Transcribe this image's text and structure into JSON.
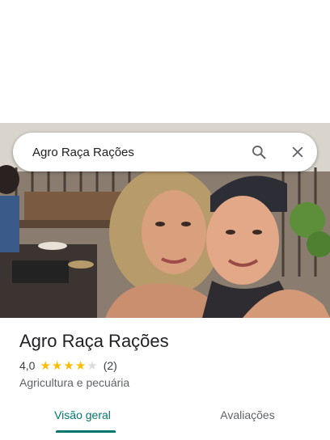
{
  "search": {
    "query": "Agro Raça Rações",
    "search_icon": "search-icon",
    "clear_icon": "close-icon"
  },
  "hero_photo": {
    "icon": "place-photo"
  },
  "place": {
    "name": "Agro Raça Rações",
    "rating": "4,0",
    "rating_value": 4,
    "max_stars": 5,
    "review_count": "(2)",
    "category": "Agricultura e pecuária"
  },
  "tabs": [
    {
      "label": "Visão geral",
      "active": true
    },
    {
      "label": "Avaliações",
      "active": false
    }
  ],
  "colors": {
    "accent": "#01766e",
    "star": "#fbbc04",
    "star_empty": "#dadce0"
  }
}
